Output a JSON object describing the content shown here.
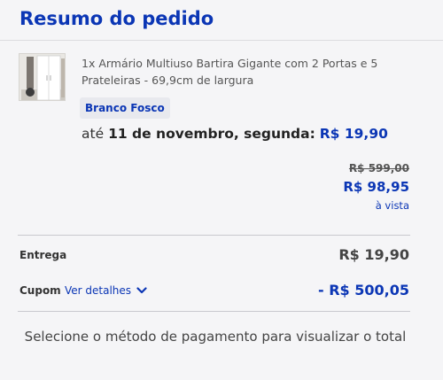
{
  "summary": {
    "title": "Resumo do pedido"
  },
  "item": {
    "name": "1x Armário Multiuso Bartira Gigante com 2 Portas e 5 Prateleiras - 69,9cm de largura",
    "variant": "Branco Fosco",
    "delivery_prefix": "até",
    "delivery_date": "11 de novembro, segunda:",
    "delivery_price": "R$ 19,90",
    "old_price": "R$ 599,00",
    "cash_price": "R$ 98,95",
    "cash_note": "à vista"
  },
  "totals": {
    "shipping_label": "Entrega",
    "shipping_value": "R$ 19,90",
    "coupon_label": "Cupom",
    "coupon_details_label": "Ver detalhes",
    "coupon_value": "- R$ 500,05"
  },
  "footer": {
    "message": "Selecione o método de pagamento para visualizar o total"
  },
  "colors": {
    "accent": "#0b36b5",
    "background": "#f5f5f7",
    "divider": "#dcdce0"
  },
  "icons": {
    "product_thumbnail": "wardrobe-image",
    "details_toggle": "chevron-down-icon"
  }
}
